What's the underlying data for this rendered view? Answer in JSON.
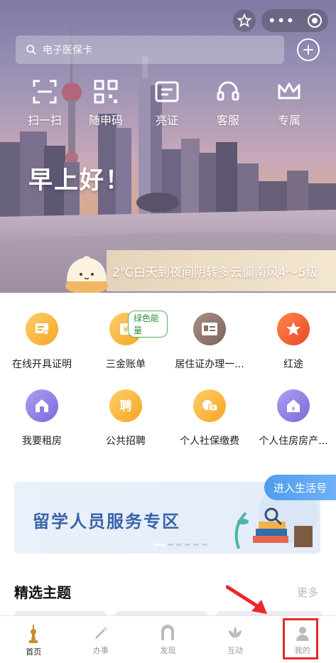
{
  "search": {
    "placeholder": "电子医保卡"
  },
  "quick_actions": [
    {
      "label": "扫一扫",
      "icon": "scan-icon"
    },
    {
      "label": "随申码",
      "icon": "qr-code-icon"
    },
    {
      "label": "亮证",
      "icon": "card-icon"
    },
    {
      "label": "客服",
      "icon": "headset-icon"
    },
    {
      "label": "专属",
      "icon": "crown-icon"
    }
  ],
  "greeting": "早上好！",
  "weather_text": "2℃白天到夜间阴转多云偏南风4～5级",
  "services": [
    {
      "label": "在线开具证明",
      "icon": "certificate-icon",
      "color": "#f5a623"
    },
    {
      "label": "三金账单",
      "icon": "yen-bill-icon",
      "color": "#f5a623",
      "badge": "绿色能量"
    },
    {
      "label": "居住证办理一...",
      "icon": "id-card-icon",
      "color": "#8a6e66"
    },
    {
      "label": "红途",
      "icon": "red-star-icon",
      "color": "#ef5a2a"
    },
    {
      "label": "我要租房",
      "icon": "house-rent-icon",
      "color": "#8d7be0"
    },
    {
      "label": "公共招聘",
      "icon": "recruit-icon",
      "color": "#f5a623"
    },
    {
      "label": "个人社保缴费",
      "icon": "social-security-icon",
      "color": "#f5a623"
    },
    {
      "label": "个人住房房产...",
      "icon": "house-yen-icon",
      "color": "#8d7be0"
    }
  ],
  "banner": {
    "title": "留学人员服务专区"
  },
  "life_button": "进入生活号",
  "section": {
    "title": "精选主题",
    "more": "更多"
  },
  "tabs": [
    {
      "label": "首页",
      "icon": "tower-icon",
      "active": true
    },
    {
      "label": "办事",
      "icon": "pen-icon",
      "active": false
    },
    {
      "label": "发现",
      "icon": "gate-icon",
      "active": false
    },
    {
      "label": "互动",
      "icon": "lotus-icon",
      "active": false
    },
    {
      "label": "我的",
      "icon": "person-icon",
      "active": false
    }
  ],
  "colors": {
    "accent": "#f5a623",
    "purple": "#8d7be0",
    "highlight": "#e8282b",
    "banner_text": "#3b63a8",
    "life_button": "#5aa4f2"
  }
}
